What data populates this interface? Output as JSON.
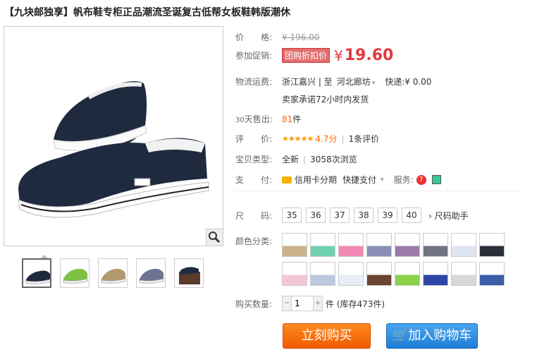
{
  "title": "【九块邮独享】帆布鞋专柜正品潮流圣诞复古低帮女板鞋韩版潮休",
  "price": {
    "label": "价　　格:",
    "original": "¥ 196.00"
  },
  "promo": {
    "label": "参加促销:",
    "tag": "团购折扣价",
    "currency": "¥",
    "value": "19.60"
  },
  "shipping": {
    "label": "物流运费:",
    "route": "浙江嘉兴 | 至",
    "to": "河北廊坊",
    "express": "快递:¥ 0.00",
    "promise": "卖家承诺72小时内发货"
  },
  "sales": {
    "label_num": "30",
    "label": "天售出:",
    "count": "81",
    "unit": "件"
  },
  "rating": {
    "label": "评　　价:",
    "stars": "★★★★★",
    "score": "4.7分",
    "reviews": "1条评价"
  },
  "type": {
    "label": "宝贝类型:",
    "value": "全新",
    "views": "3058次浏览"
  },
  "payment": {
    "label": "支　　付:",
    "credit": "信用卡分期",
    "quick": "快捷支付",
    "service": "服务:"
  },
  "sizes": {
    "label": "尺　　码:",
    "options": [
      "35",
      "36",
      "37",
      "38",
      "39",
      "40"
    ],
    "guide": "尺码助手"
  },
  "colors": {
    "label": "颜色分类:"
  },
  "quantity": {
    "label": "购买数量:",
    "value": "1",
    "unit": "件 (库存473件)"
  },
  "buttons": {
    "buy": "立刻购买",
    "cart": "加入购物车"
  },
  "colors_hex": {
    "accent": "#e4393c",
    "buy": "#f26a10",
    "cart": "#2b8ae0"
  }
}
